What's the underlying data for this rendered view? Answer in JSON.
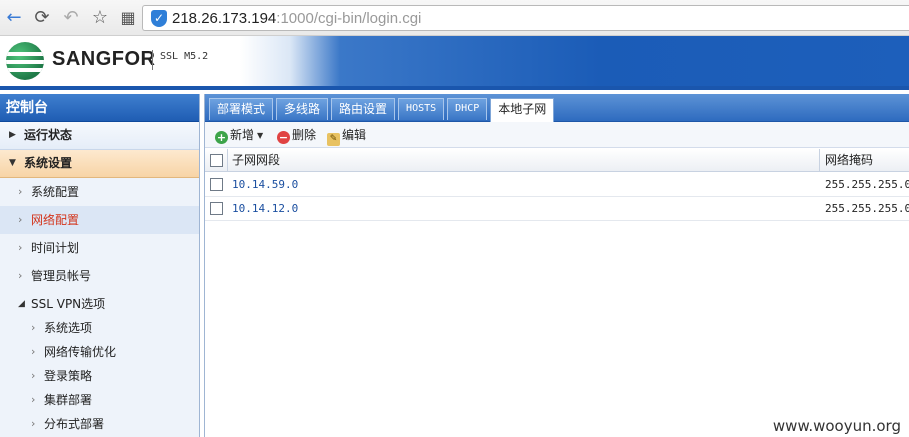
{
  "browser": {
    "url_host": "218.26.173.194",
    "url_rest": ":1000/cgi-bin/login.cgi",
    "back_icon": "←",
    "refresh_icon": "⟳",
    "undo_icon": "↶",
    "star_icon": "☆",
    "apps_icon": "▦"
  },
  "header": {
    "brand": "SANGFOR",
    "version": "SSL M5.2"
  },
  "sidebar": {
    "title": "控制台",
    "groups": [
      {
        "label": "运行状态",
        "arrow": "▶"
      },
      {
        "label": "系统设置",
        "arrow": "▼"
      }
    ],
    "items": [
      {
        "label": "系统配置"
      },
      {
        "label": "网络配置"
      },
      {
        "label": "时间计划"
      },
      {
        "label": "管理员帐号"
      }
    ],
    "sub_group": {
      "label": "SSL VPN选项",
      "arrow": "◢"
    },
    "leaves": [
      {
        "label": "系统选项"
      },
      {
        "label": "网络传输优化"
      },
      {
        "label": "登录策略"
      },
      {
        "label": "集群部署"
      },
      {
        "label": "分布式部署"
      }
    ]
  },
  "tabs": [
    {
      "label": "部署模式"
    },
    {
      "label": "多线路"
    },
    {
      "label": "路由设置"
    },
    {
      "label": "HOSTS"
    },
    {
      "label": "DHCP"
    },
    {
      "label": "本地子网"
    }
  ],
  "toolbar": {
    "add_label": "新增",
    "delete_label": "删除",
    "edit_label": "编辑"
  },
  "grid": {
    "columns": [
      "子网网段",
      "网络掩码"
    ],
    "rows": [
      {
        "network": "10.14.59.0",
        "mask": "255.255.255.0"
      },
      {
        "network": "10.14.12.0",
        "mask": "255.255.255.0"
      }
    ]
  },
  "watermark": "www.wooyun.org",
  "colors": {
    "accent": "#1f5db3",
    "active_group": "#f7d4a6",
    "current_item_text": "#d3341b"
  }
}
